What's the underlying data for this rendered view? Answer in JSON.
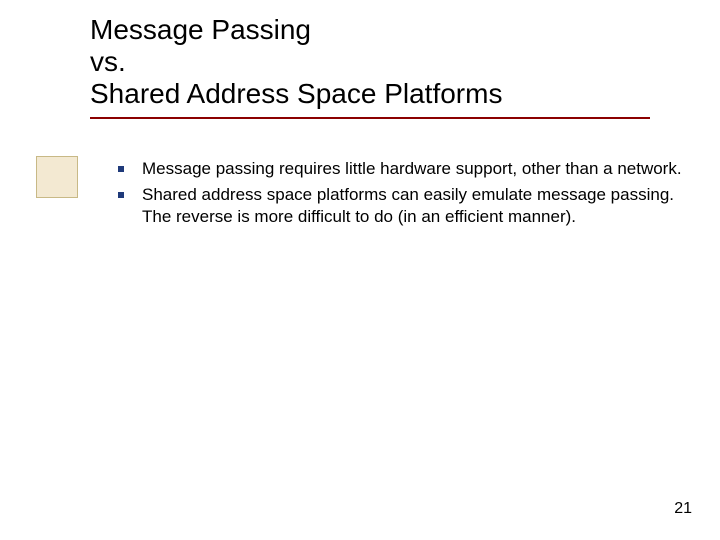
{
  "title": {
    "line1": "Message Passing",
    "line2": "vs.",
    "line3": "Shared Address Space Platforms"
  },
  "bullets": [
    "Message passing requires little hardware support, other than a network.",
    "Shared address space platforms can easily emulate message passing. The reverse is more difficult to do (in an efficient manner)."
  ],
  "page_number": "21"
}
